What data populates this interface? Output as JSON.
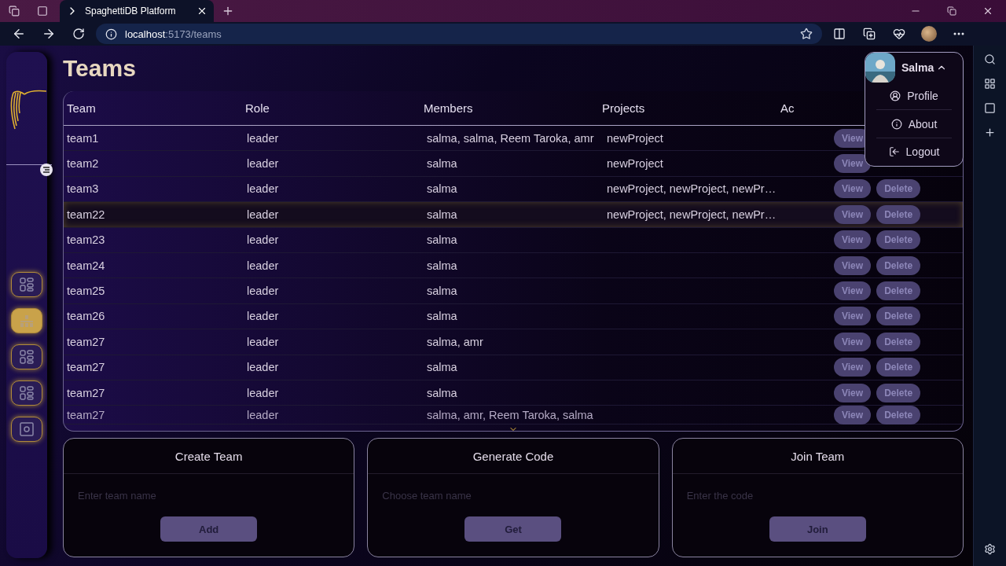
{
  "browser": {
    "tab_title": "SpaghettiDB Platform",
    "url_host": "localhost",
    "url_path": ":5173/teams"
  },
  "sidebar": {
    "items": [
      {
        "kind": "grid",
        "selected": false
      },
      {
        "kind": "chart",
        "selected": true
      },
      {
        "kind": "grid",
        "selected": false
      },
      {
        "kind": "grid",
        "selected": false
      },
      {
        "kind": "settings",
        "selected": false
      }
    ]
  },
  "page": {
    "title": "Teams"
  },
  "table": {
    "columns": [
      "Team",
      "Role",
      "Members",
      "Projects",
      "Ac"
    ],
    "rows": [
      {
        "team": "team1",
        "role": "leader",
        "members": "salma, salma, Reem Taroka, amr",
        "projects": "newProject",
        "actions": [
          "View"
        ],
        "highlighted": false,
        "blurred": false
      },
      {
        "team": "team2",
        "role": "leader",
        "members": "salma",
        "projects": "newProject",
        "actions": [
          "View"
        ],
        "highlighted": false,
        "blurred": false
      },
      {
        "team": "team3",
        "role": "leader",
        "members": "salma",
        "projects": "newProject, newProject, newPr…",
        "actions": [
          "View",
          "Delete"
        ],
        "highlighted": false,
        "blurred": false
      },
      {
        "team": "team22",
        "role": "leader",
        "members": "salma",
        "projects": "newProject, newProject, newPr…",
        "actions": [
          "View",
          "Delete"
        ],
        "highlighted": true,
        "blurred": false
      },
      {
        "team": "team23",
        "role": "leader",
        "members": "salma",
        "projects": "",
        "actions": [
          "View",
          "Delete"
        ],
        "highlighted": false,
        "blurred": false
      },
      {
        "team": "team24",
        "role": "leader",
        "members": "salma",
        "projects": "",
        "actions": [
          "View",
          "Delete"
        ],
        "highlighted": false,
        "blurred": false
      },
      {
        "team": "team25",
        "role": "leader",
        "members": "salma",
        "projects": "",
        "actions": [
          "View",
          "Delete"
        ],
        "highlighted": false,
        "blurred": false
      },
      {
        "team": "team26",
        "role": "leader",
        "members": "salma",
        "projects": "",
        "actions": [
          "View",
          "Delete"
        ],
        "highlighted": false,
        "blurred": false
      },
      {
        "team": "team27",
        "role": "leader",
        "members": "salma, amr",
        "projects": "",
        "actions": [
          "View",
          "Delete"
        ],
        "highlighted": false,
        "blurred": false
      },
      {
        "team": "team27",
        "role": "leader",
        "members": "salma",
        "projects": "",
        "actions": [
          "View",
          "Delete"
        ],
        "highlighted": false,
        "blurred": false
      },
      {
        "team": "team27",
        "role": "leader",
        "members": "salma",
        "projects": "",
        "actions": [
          "View",
          "Delete"
        ],
        "highlighted": false,
        "blurred": false
      },
      {
        "team": "team27",
        "role": "leader",
        "members": "salma, amr, Reem Taroka, salma",
        "projects": "",
        "actions": [
          "View",
          "Delete"
        ],
        "highlighted": false,
        "blurred": true
      }
    ]
  },
  "cards": [
    {
      "title": "Create Team",
      "placeholder": "Enter team name",
      "button": "Add"
    },
    {
      "title": "Generate Code",
      "placeholder": "Choose team name",
      "button": "Get"
    },
    {
      "title": "Join Team",
      "placeholder": "Enter the code",
      "button": "Join"
    }
  ],
  "user_menu": {
    "name": "Salma",
    "expanded": true,
    "items": [
      {
        "kind": "profile",
        "label": "Profile"
      },
      {
        "kind": "about",
        "label": "About"
      },
      {
        "kind": "logout",
        "label": "Logout"
      }
    ]
  }
}
